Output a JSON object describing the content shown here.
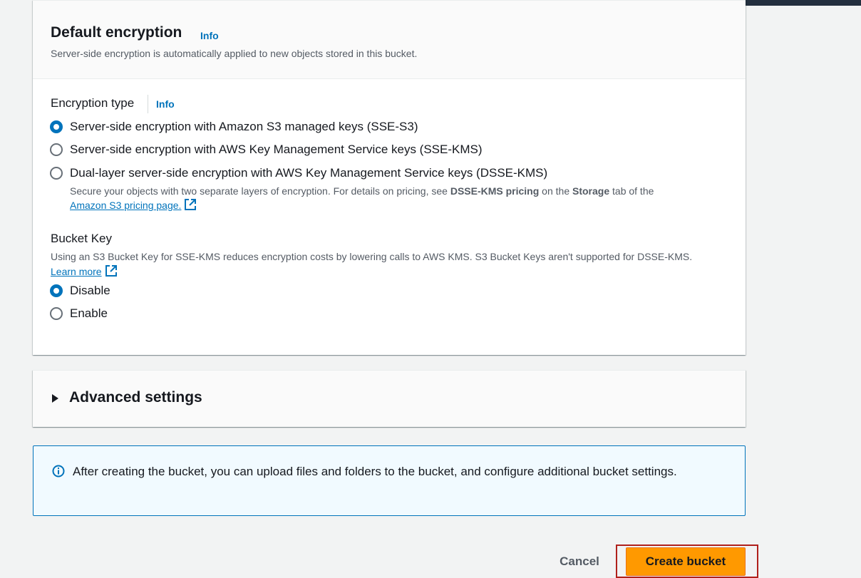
{
  "encryption": {
    "title": "Default encryption",
    "info": "Info",
    "description": "Server-side encryption is automatically applied to new objects stored in this bucket.",
    "type_label": "Encryption type",
    "type_info": "Info",
    "options": [
      {
        "label": "Server-side encryption with Amazon S3 managed keys (SSE-S3)",
        "selected": true
      },
      {
        "label": "Server-side encryption with AWS Key Management Service keys (SSE-KMS)",
        "selected": false
      },
      {
        "label": "Dual-layer server-side encryption with AWS Key Management Service keys (DSSE-KMS)",
        "selected": false
      }
    ],
    "dsse_desc_prefix": "Secure your objects with two separate layers of encryption. For details on pricing, see ",
    "dsse_desc_bold1": "DSSE-KMS pricing",
    "dsse_desc_mid": " on the ",
    "dsse_desc_bold2": "Storage",
    "dsse_desc_suffix": " tab of the",
    "dsse_pricing_link": "Amazon S3 pricing page."
  },
  "bucket_key": {
    "label": "Bucket Key",
    "description": "Using an S3 Bucket Key for SSE-KMS reduces encryption costs by lowering calls to AWS KMS. S3 Bucket Keys aren't supported for DSSE-KMS.",
    "learn_more": "Learn more",
    "options": [
      {
        "label": "Disable",
        "selected": true
      },
      {
        "label": "Enable",
        "selected": false
      }
    ]
  },
  "advanced": {
    "title": "Advanced settings",
    "expanded": false
  },
  "alert": {
    "icon": "info-circle-icon",
    "text": "After creating the bucket, you can upload files and folders to the bucket, and configure additional bucket settings."
  },
  "footer": {
    "cancel_label": "Cancel",
    "create_label": "Create bucket"
  },
  "colors": {
    "accent": "#0073bb",
    "primary_button": "#ff9900",
    "highlight": "#b0201b"
  }
}
